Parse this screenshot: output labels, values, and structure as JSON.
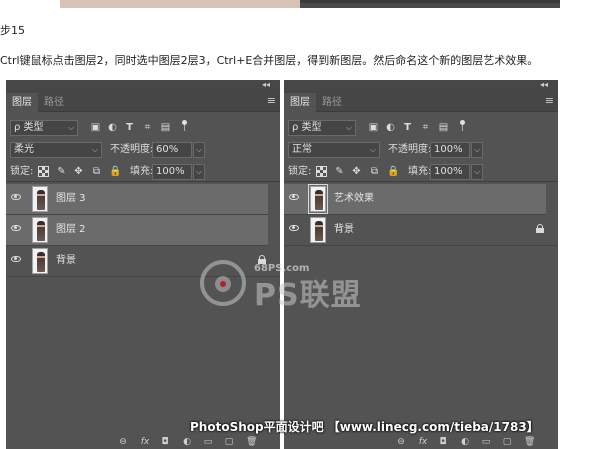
{
  "article": {
    "step_label": "步15",
    "instruction": "Ctrl键鼠标点击图层2，同时选中图层2层3，Ctrl+E合并图层，得到新图层。然后命名这个新的图层艺术效果。"
  },
  "panels": {
    "left": {
      "collapse": "◂◂",
      "tabs": [
        "图层",
        "路径"
      ],
      "filter_kind": "ρ 类型",
      "blend_mode": "柔光",
      "opacity_label": "不透明度:",
      "opacity_value": "60%",
      "lock_label": "锁定:",
      "fill_label": "填充:",
      "fill_value": "100%",
      "layers": [
        {
          "name": "图层 3",
          "selected": true,
          "locked": false
        },
        {
          "name": "图层 2",
          "selected": true,
          "locked": false
        },
        {
          "name": "背景",
          "selected": false,
          "locked": true
        }
      ]
    },
    "right": {
      "collapse": "◂◂",
      "tabs": [
        "图层",
        "路径"
      ],
      "filter_kind": "ρ 类型",
      "blend_mode": "正常",
      "opacity_label": "不透明度:",
      "opacity_value": "100%",
      "lock_label": "锁定:",
      "fill_label": "填充:",
      "fill_value": "100%",
      "layers": [
        {
          "name": "艺术效果",
          "selected": true,
          "locked": false
        },
        {
          "name": "背景",
          "selected": false,
          "locked": true
        }
      ]
    }
  },
  "icons": {
    "filter_icons": [
      "image-filter-icon",
      "adjustment-filter-icon",
      "type-filter-icon",
      "shape-filter-icon",
      "smart-object-filter-icon",
      "filter-toggle-icon"
    ],
    "lock_icons": [
      "lock-transparent-icon",
      "lock-image-icon",
      "lock-position-icon",
      "lock-artboard-icon",
      "lock-all-icon"
    ],
    "footer_icons": [
      "link-icon",
      "fx-icon",
      "mask-icon",
      "adjustment-layer-icon",
      "group-icon",
      "new-layer-icon",
      "delete-icon"
    ],
    "footer_glyphs": [
      "⊖",
      "fx",
      "◘",
      "◐",
      "▭",
      "▢",
      "🗑"
    ]
  },
  "watermark": {
    "site": "68PS.com",
    "brand": "PS联盟",
    "banner": "PhotoShop平面设计吧 【www.linecg.com/tieba/1783】"
  },
  "colors": {
    "panel_bg": "#535353",
    "selected_row": "#6b6b6b",
    "tab_bar": "#464646",
    "text": "#e6e6e6"
  }
}
